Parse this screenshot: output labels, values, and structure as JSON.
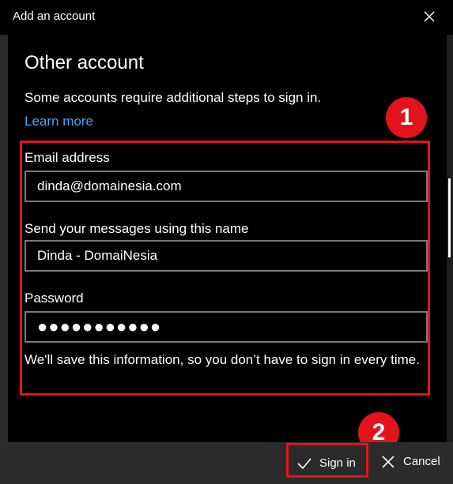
{
  "window": {
    "title": "Add an account"
  },
  "page": {
    "heading": "Other account",
    "description": "Some accounts require additional steps to sign in.",
    "learn_more": "Learn more"
  },
  "form": {
    "email_label": "Email address",
    "email_value": "dinda@domainesia.com",
    "name_label": "Send your messages using this name",
    "name_value": "Dinda - DomaiNesia",
    "password_label": "Password",
    "password_value": "●●●●●●●●●●●",
    "note": "We'll save this information, so you don’t have to sign in every time."
  },
  "annotations": {
    "step1": "1",
    "step2": "2"
  },
  "footer": {
    "signin_label": "Sign in",
    "cancel_label": "Cancel"
  },
  "colors": {
    "accent_red": "#e3131b",
    "link_blue": "#4aa3f0",
    "background": "#000000",
    "footer_bg": "#2b2b2b"
  },
  "icons": {
    "close": "close-icon",
    "signin": "checkmark-icon",
    "cancel": "x-icon"
  }
}
